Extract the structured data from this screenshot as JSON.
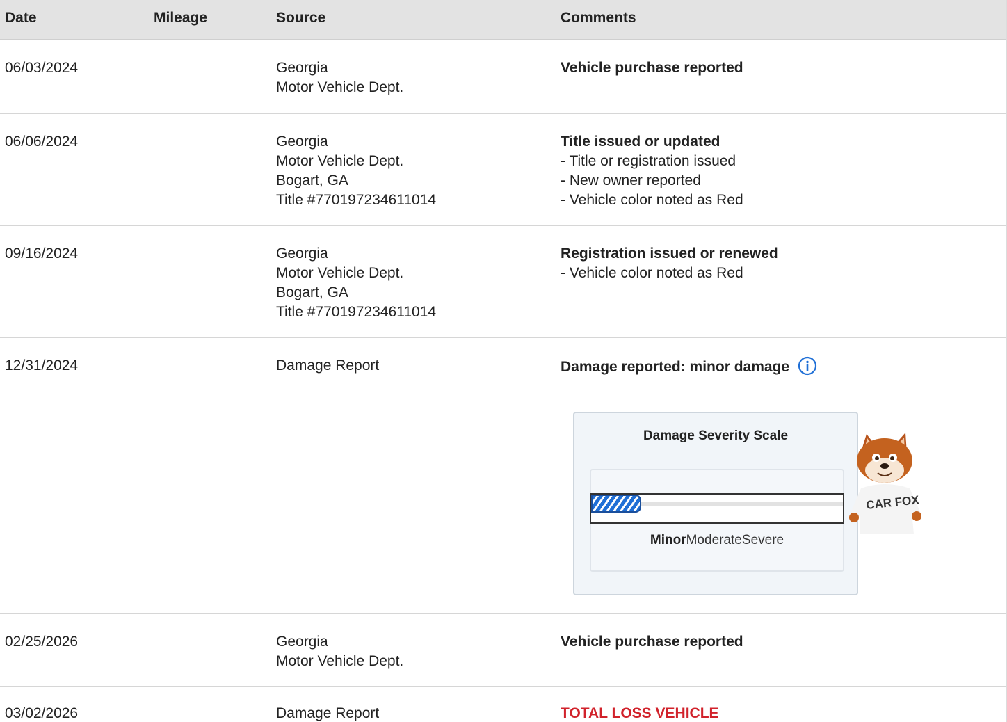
{
  "headers": {
    "date": "Date",
    "mileage": "Mileage",
    "source": "Source",
    "comments": "Comments"
  },
  "rows": [
    {
      "date": "06/03/2024",
      "mileage": "",
      "source": [
        "Georgia",
        "Motor Vehicle Dept."
      ],
      "comment_title": "Vehicle purchase reported",
      "comment_lines": []
    },
    {
      "date": "06/06/2024",
      "mileage": "",
      "source": [
        "Georgia",
        "Motor Vehicle Dept.",
        "Bogart, GA",
        "Title #770197234611014"
      ],
      "comment_title": "Title issued or updated",
      "comment_lines": [
        "- Title or registration issued",
        "- New owner reported",
        "- Vehicle color noted as Red"
      ]
    },
    {
      "date": "09/16/2024",
      "mileage": "",
      "source": [
        "Georgia",
        "Motor Vehicle Dept.",
        "Bogart, GA",
        "Title #770197234611014"
      ],
      "comment_title": "Registration issued or renewed",
      "comment_lines": [
        "- Vehicle color noted as Red"
      ]
    },
    {
      "date": "12/31/2024",
      "mileage": "",
      "source": [
        "Damage Report"
      ],
      "comment_title": "Damage reported: minor damage",
      "comment_lines": []
    },
    {
      "date": "02/25/2026",
      "mileage": "",
      "source": [
        "Georgia",
        "Motor Vehicle Dept."
      ],
      "comment_title": "Vehicle purchase reported",
      "comment_lines": []
    },
    {
      "date": "03/02/2026",
      "mileage": "",
      "source": [
        "Damage Report"
      ],
      "comment_title": "TOTAL LOSS VEHICLE",
      "comment_lines": []
    }
  ],
  "severity": {
    "title": "Damage Severity Scale",
    "levels": [
      "Minor",
      "Moderate",
      "Severe"
    ],
    "active_level": "Minor",
    "fill_fraction": 0.2
  },
  "mascot": {
    "shirt_text": "CAR FOX"
  },
  "colors": {
    "header_bg": "#e3e3e3",
    "accent_blue": "#1f6fd6",
    "total_loss_red": "#d1222b"
  },
  "icons": {
    "info": "info-circle-icon"
  }
}
